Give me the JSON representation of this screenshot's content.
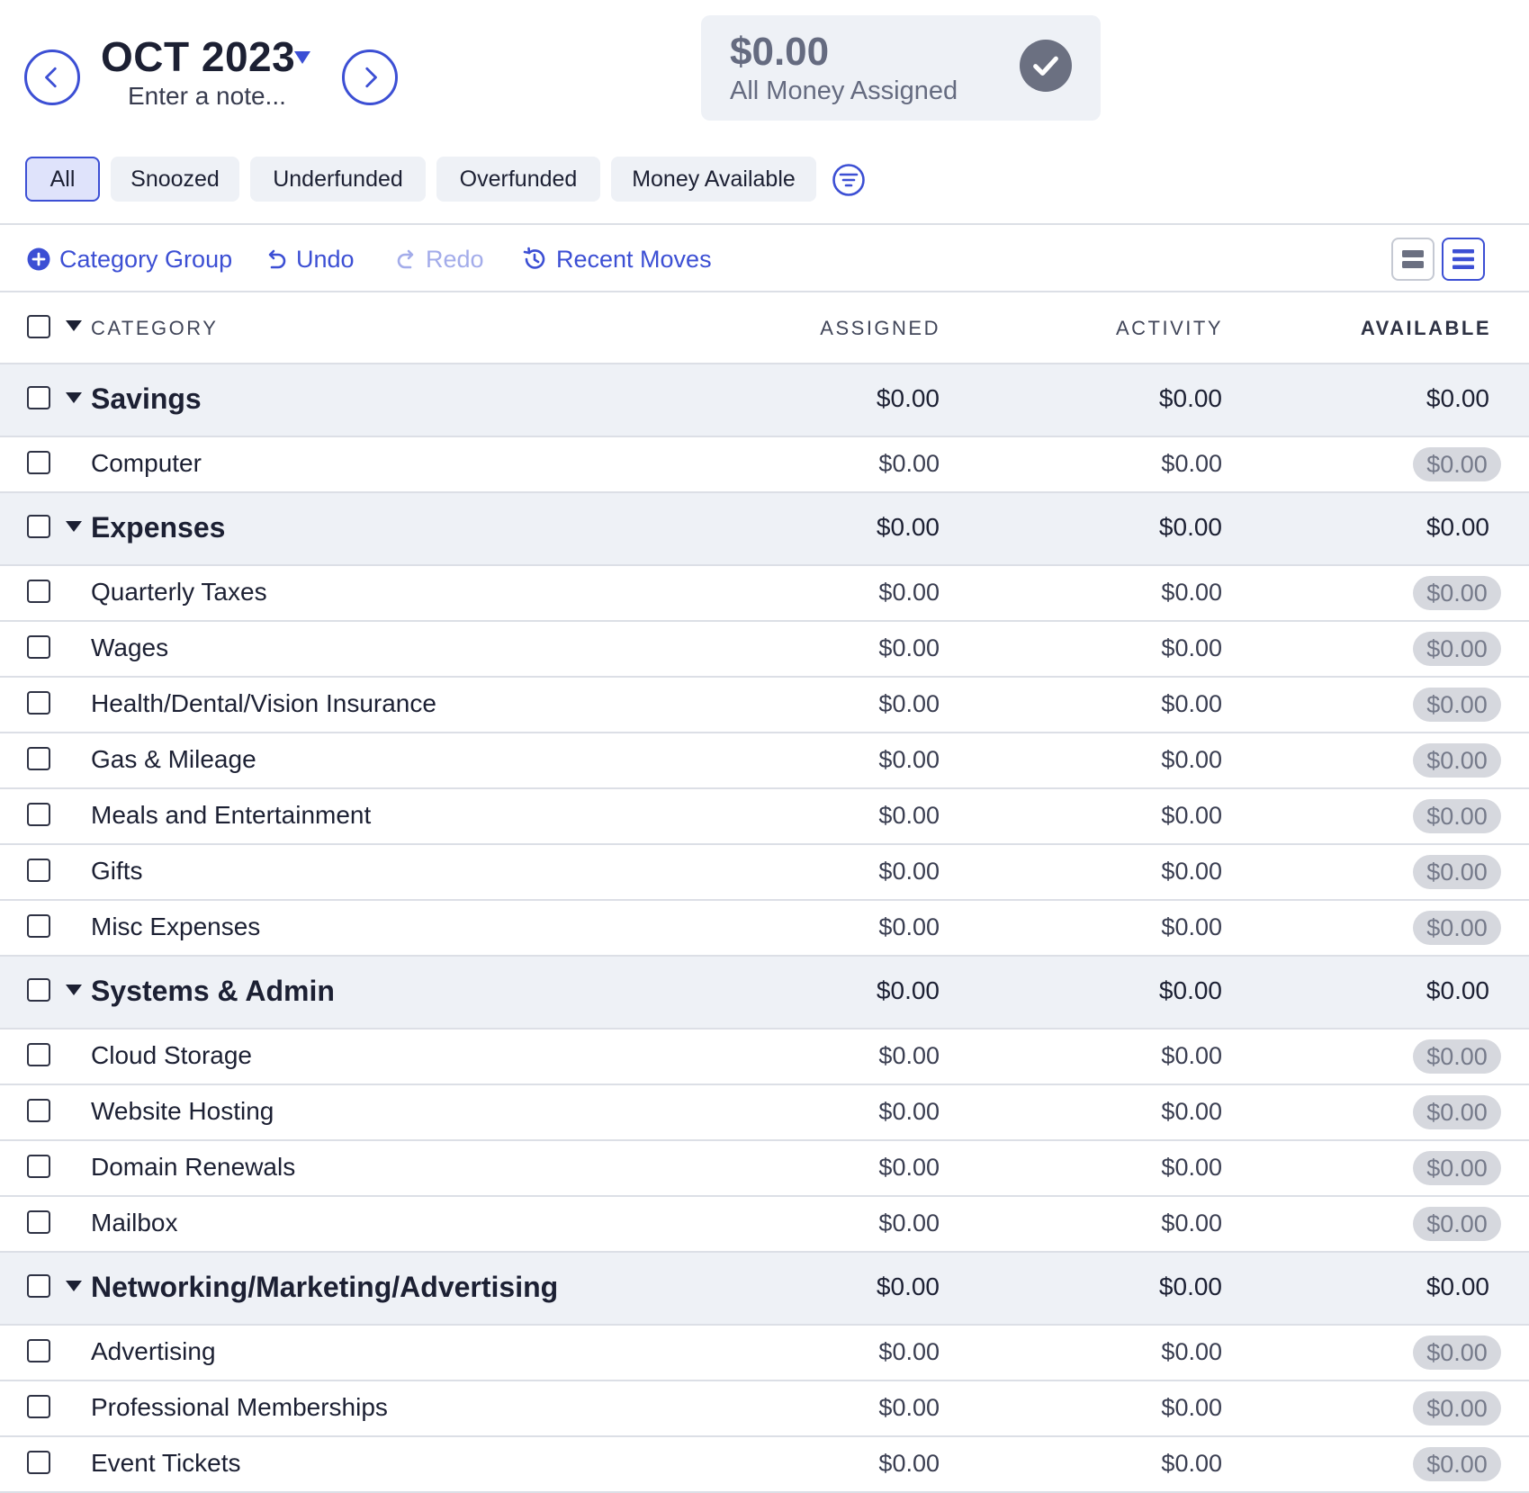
{
  "header": {
    "month_label": "OCT 2023",
    "note_placeholder": "Enter a note...",
    "ready_to_assign": {
      "amount": "$0.00",
      "label": "All Money Assigned"
    }
  },
  "filters": {
    "pills": [
      "All",
      "Snoozed",
      "Underfunded",
      "Overfunded",
      "Money Available"
    ],
    "active": "All"
  },
  "toolbar": {
    "category_group": "Category Group",
    "undo": "Undo",
    "redo": "Redo",
    "recent_moves": "Recent Moves"
  },
  "table": {
    "columns": {
      "category": "CATEGORY",
      "assigned": "ASSIGNED",
      "activity": "ACTIVITY",
      "available": "AVAILABLE"
    },
    "groups": [
      {
        "name": "Savings",
        "assigned": "$0.00",
        "activity": "$0.00",
        "available": "$0.00",
        "categories": [
          {
            "name": "Computer",
            "assigned": "$0.00",
            "activity": "$0.00",
            "available": "$0.00"
          }
        ]
      },
      {
        "name": "Expenses",
        "assigned": "$0.00",
        "activity": "$0.00",
        "available": "$0.00",
        "categories": [
          {
            "name": "Quarterly Taxes",
            "assigned": "$0.00",
            "activity": "$0.00",
            "available": "$0.00"
          },
          {
            "name": "Wages",
            "assigned": "$0.00",
            "activity": "$0.00",
            "available": "$0.00"
          },
          {
            "name": "Health/Dental/Vision Insurance",
            "assigned": "$0.00",
            "activity": "$0.00",
            "available": "$0.00"
          },
          {
            "name": "Gas & Mileage",
            "assigned": "$0.00",
            "activity": "$0.00",
            "available": "$0.00"
          },
          {
            "name": "Meals and Entertainment",
            "assigned": "$0.00",
            "activity": "$0.00",
            "available": "$0.00"
          },
          {
            "name": "Gifts",
            "assigned": "$0.00",
            "activity": "$0.00",
            "available": "$0.00"
          },
          {
            "name": "Misc Expenses",
            "assigned": "$0.00",
            "activity": "$0.00",
            "available": "$0.00"
          }
        ]
      },
      {
        "name": "Systems & Admin",
        "assigned": "$0.00",
        "activity": "$0.00",
        "available": "$0.00",
        "categories": [
          {
            "name": "Cloud Storage",
            "assigned": "$0.00",
            "activity": "$0.00",
            "available": "$0.00"
          },
          {
            "name": "Website Hosting",
            "assigned": "$0.00",
            "activity": "$0.00",
            "available": "$0.00"
          },
          {
            "name": "Domain Renewals",
            "assigned": "$0.00",
            "activity": "$0.00",
            "available": "$0.00"
          },
          {
            "name": "Mailbox",
            "assigned": "$0.00",
            "activity": "$0.00",
            "available": "$0.00"
          }
        ]
      },
      {
        "name": "Networking/Marketing/Advertising",
        "assigned": "$0.00",
        "activity": "$0.00",
        "available": "$0.00",
        "categories": [
          {
            "name": "Advertising",
            "assigned": "$0.00",
            "activity": "$0.00",
            "available": "$0.00"
          },
          {
            "name": "Professional Memberships",
            "assigned": "$0.00",
            "activity": "$0.00",
            "available": "$0.00"
          },
          {
            "name": "Event Tickets",
            "assigned": "$0.00",
            "activity": "$0.00",
            "available": "$0.00"
          }
        ]
      }
    ]
  },
  "colors": {
    "accent": "#3c4fd4",
    "group_row_bg": "#eef1f6",
    "available_pill_bg": "#d6d8de",
    "text_primary": "#1c2033"
  },
  "icons": {
    "prev_month": "chevron-left-circle-icon",
    "next_month": "chevron-right-circle-icon",
    "month_dropdown": "caret-down-icon",
    "ready_status": "checkmark-circle-icon",
    "filter": "filter-lines-icon",
    "category_group": "plus-circle-icon",
    "undo": "undo-arrow-icon",
    "redo": "redo-arrow-icon",
    "recent_moves": "history-clock-icon",
    "view_compact": "view-compact-icon",
    "view_expanded": "view-expanded-icon"
  }
}
